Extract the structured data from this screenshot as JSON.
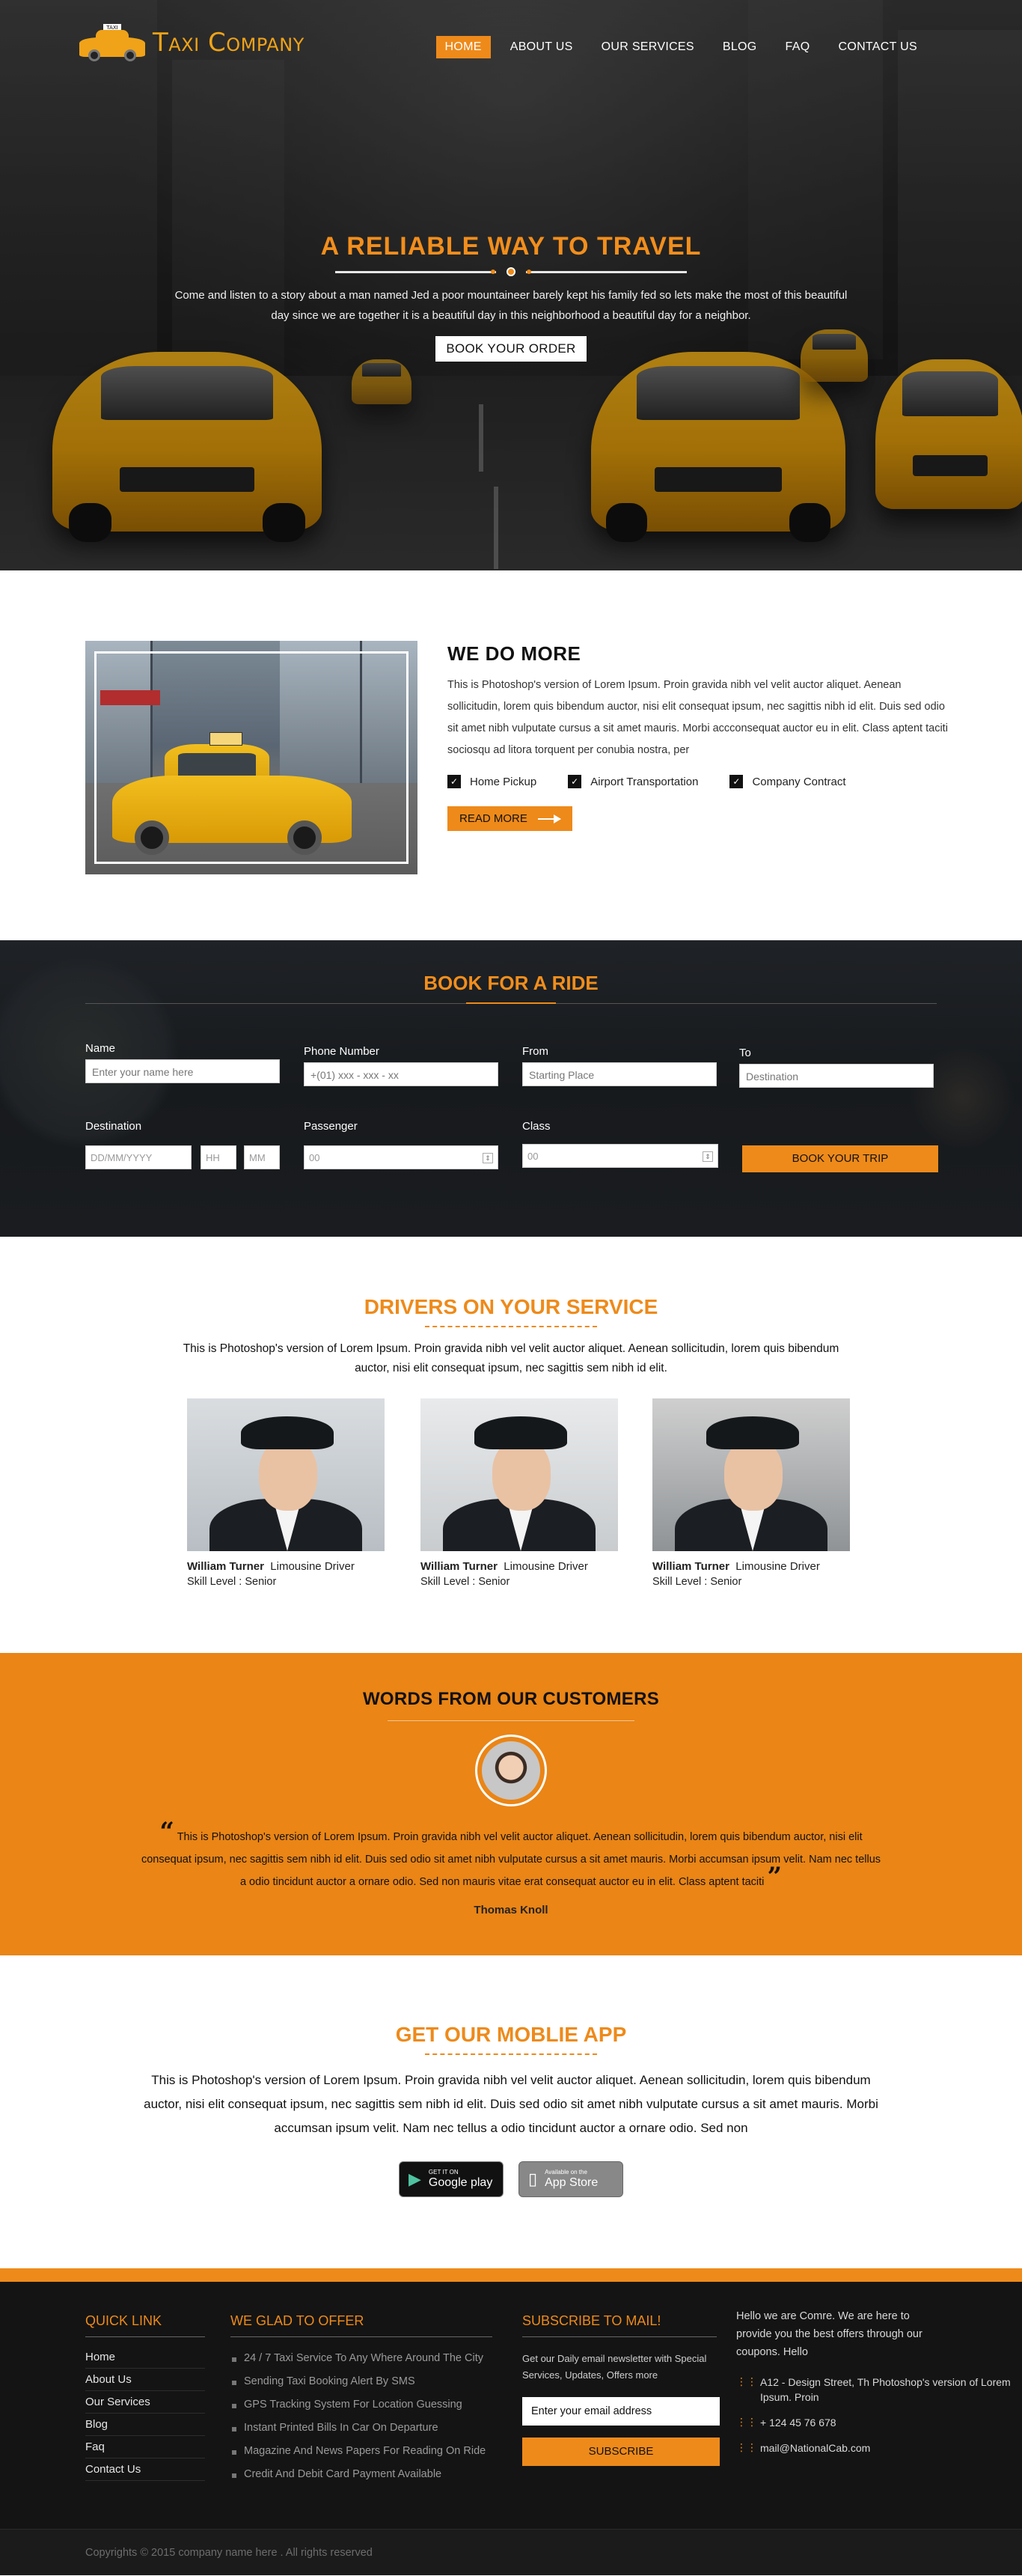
{
  "brand": {
    "name": "Taxi Company",
    "sign": "TAXI"
  },
  "nav": [
    {
      "label": "HOME",
      "active": true
    },
    {
      "label": "ABOUT US"
    },
    {
      "label": "OUR SERVICES"
    },
    {
      "label": "BLOG"
    },
    {
      "label": "FAQ"
    },
    {
      "label": "CONTACT US"
    }
  ],
  "hero": {
    "title": "A RELIABLE WAY TO TRAVEL",
    "text": "Come and listen to a story about a man named Jed a poor mountaineer barely kept his family fed so lets make the most of this beautiful day since we are together it is a beautiful day in this neighborhood a beautiful day for a neighbor.",
    "button": "BOOK YOUR ORDER"
  },
  "domore": {
    "title": "WE DO MORE",
    "text": "This is Photoshop's version  of Lorem Ipsum. Proin gravida nibh vel velit auctor aliquet. Aenean sollicitudin, lorem quis bibendum auctor, nisi elit consequat ipsum, nec sagittis nibh id elit. Duis sed odio sit amet nibh vulputate cursus a sit amet mauris. Morbi accconsequat auctor eu in elit. Class aptent taciti sociosqu ad litora torquent per conubia nostra, per",
    "checks": [
      "Home Pickup",
      "Airport Transportation",
      "Company Contract"
    ],
    "button": "READ MORE"
  },
  "book": {
    "title": "BOOK FOR A RIDE",
    "name_label": "Name",
    "name_placeholder": "Enter your name here",
    "phone_label": "Phone Number",
    "phone_placeholder": "+(01) xxx - xxx - xx",
    "from_label": "From",
    "from_placeholder": "Starting Place",
    "to_label": "To",
    "to_placeholder": "Destination",
    "dest_label": "Destination",
    "date_placeholder": "DD/MM/YYYY",
    "hh": "HH",
    "mm": "MM",
    "passenger_label": "Passenger",
    "passenger_value": "00",
    "class_label": "Class",
    "class_value": "00",
    "button": "BOOK YOUR TRIP"
  },
  "drivers": {
    "title": "DRIVERS ON YOUR SERVICE",
    "intro": "This is Photoshop's version  of Lorem Ipsum. Proin gravida nibh vel velit auctor aliquet. Aenean sollicitudin, lorem quis bibendum auctor, nisi elit consequat ipsum, nec sagittis sem nibh id elit.",
    "list": [
      {
        "name": "William Turner",
        "role": "Limousine Driver",
        "skill": "Skill Level : Senior"
      },
      {
        "name": "William Turner",
        "role": "Limousine Driver",
        "skill": "Skill Level : Senior"
      },
      {
        "name": "William Turner",
        "role": "Limousine Driver",
        "skill": "Skill Level : Senior"
      }
    ]
  },
  "testimonial": {
    "title": "WORDS FROM OUR CUSTOMERS",
    "quote": "This is Photoshop's version  of Lorem Ipsum. Proin gravida nibh vel velit auctor aliquet. Aenean sollicitudin, lorem quis bibendum auctor, nisi elit consequat ipsum, nec sagittis sem nibh id elit. Duis sed odio sit amet nibh vulputate cursus a sit amet mauris. Morbi accumsan ipsum velit. Nam nec tellus a odio tincidunt auctor a ornare odio. Sed non  mauris vitae erat consequat auctor eu in elit. Class aptent taciti",
    "open_mark": "“",
    "close_mark": "”",
    "author": "Thomas Knoll"
  },
  "app": {
    "title": "GET OUR MOBLIE APP",
    "text": "This is Photoshop's version  of Lorem Ipsum. Proin gravida nibh vel velit auctor aliquet. Aenean sollicitudin, lorem quis bibendum auctor, nisi elit consequat ipsum, nec sagittis sem nibh id elit. Duis sed odio sit amet nibh vulputate cursus a sit amet mauris. Morbi accumsan ipsum velit. Nam nec tellus a odio tincidunt auctor a ornare odio. Sed non",
    "google_small": "GET IT ON",
    "google_big": "Google play",
    "apple_small": "Available on the",
    "apple_big": "App Store"
  },
  "footer": {
    "quick_title": "QUICK LINK",
    "quick_links": [
      "Home",
      "About Us",
      "Our Services",
      "Blog",
      "Faq",
      "Contact Us"
    ],
    "offer_title": "WE GLAD TO OFFER",
    "offers": [
      "24 / 7 Taxi Service To Any Where Around The City",
      "Sending Taxi Booking Alert By SMS",
      "GPS Tracking System For Location Guessing",
      "Instant Printed Bills In Car On Departure",
      "Magazine And News Papers For Reading On Ride",
      "Credit And Debit Card Payment Available"
    ],
    "sub_title": "SUBSCRIBE TO MAIL!",
    "sub_text": "Get our Daily email newsletter with Special Services, Updates, Offers more",
    "sub_placeholder": "Enter your email address",
    "sub_button": "SUBSCRIBE",
    "about": "Hello we are Comre. We are here to provide you the best offers through our coupons. Hello",
    "address": "A12 - Design Street, Th Photoshop's version  of Lorem Ipsum. Proin",
    "phone": "+ 124 45 76 678",
    "email": "mail@NationalCab.com",
    "copyright": "Copyrights © 2015 company name here . All rights reserved"
  },
  "colors": {
    "accent": "#ee8a1a",
    "dark": "#141414"
  }
}
